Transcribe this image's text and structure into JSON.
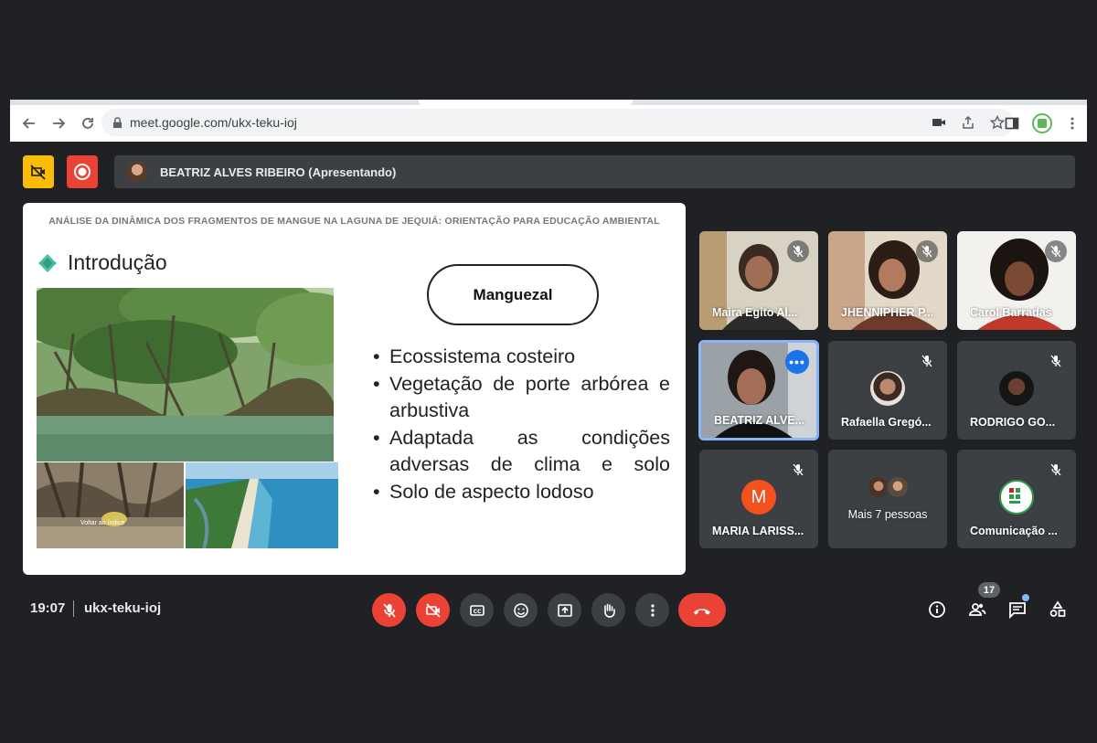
{
  "browser": {
    "url": "meet.google.com/ukx-teku-ioj"
  },
  "presenter": {
    "label": "BEATRIZ ALVES RIBEIRO (Apresentando)"
  },
  "slide": {
    "header": "ANÁLISE DA DINÂMICA DOS FRAGMENTOS DE MANGUE NA LAGUNA DE JEQUIÁ: ORIENTAÇÃO PARA EDUCAÇÃO AMBIENTAL",
    "section_title": "Introdução",
    "pill_label": "Manguezal",
    "image_caption": "Voltar ao índice",
    "bullets": [
      "Ecossistema costeiro",
      "Vegetação de porte arbórea e arbustiva",
      "Adaptada as condições adversas de clima e solo",
      "Solo de aspecto lodoso"
    ]
  },
  "participants": [
    {
      "name": "Maira Egito Al...",
      "muted": true
    },
    {
      "name": "JHENNIPHER P...",
      "muted": true
    },
    {
      "name": "Carol Barradas",
      "muted": true
    },
    {
      "name": "BEATRIZ ALVE...",
      "muted": false,
      "speaking": true
    },
    {
      "name": "Rafaella Gregó...",
      "muted": true
    },
    {
      "name": "RODRIGO GO...",
      "muted": true
    },
    {
      "name": "MARIA LARISS...",
      "muted": true,
      "initial": "M",
      "avatar_color": "#f4511e"
    },
    {
      "name": "Mais 7 pessoas"
    },
    {
      "name": "Comunicação ...",
      "muted": true
    }
  ],
  "bottom_bar": {
    "time": "19:07",
    "meeting_code": "ukx-teku-ioj",
    "participant_count": "17"
  },
  "colors": {
    "background": "#202124",
    "danger": "#ea4335",
    "record_button": "#ea4335",
    "no_camera_button": "#fbbc04",
    "active_border": "#8ab4f8"
  },
  "icons": [
    "back-icon",
    "forward-icon",
    "reload-icon",
    "lock-icon",
    "camera-blocked-icon",
    "share-icon",
    "star-icon",
    "side-panel-icon",
    "extension-icon",
    "kebab-icon",
    "mic-off-icon",
    "video-off-icon",
    "captions-icon",
    "emoji-icon",
    "present-icon",
    "raise-hand-icon",
    "more-icon",
    "end-call-icon",
    "info-icon",
    "people-icon",
    "chat-icon",
    "activities-icon"
  ]
}
